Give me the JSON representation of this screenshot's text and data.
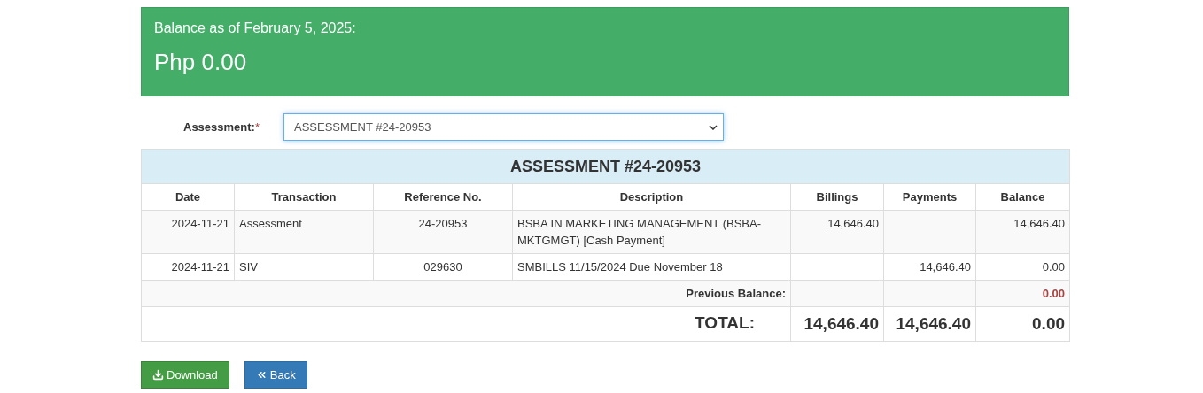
{
  "balance_card": {
    "caption": "Balance as of February 5, 2025:",
    "amount": "Php 0.00"
  },
  "assessment_select": {
    "label": "Assessment:",
    "required_mark": "*",
    "value": "ASSESSMENT #24-20953"
  },
  "table": {
    "title": "ASSESSMENT #24-20953",
    "columns": [
      "Date",
      "Transaction",
      "Reference No.",
      "Description",
      "Billings",
      "Payments",
      "Balance"
    ],
    "rows": [
      {
        "date": "2024-11-21",
        "transaction": "Assessment",
        "reference": "24-20953",
        "description": "BSBA IN MARKETING MANAGEMENT (BSBA-MKTGMGT) [Cash Payment]",
        "billings": "14,646.40",
        "payments": "",
        "balance": "14,646.40"
      },
      {
        "date": "2024-11-21",
        "transaction": "SIV",
        "reference": "029630",
        "description": "SMBILLS 11/15/2024 Due November 18",
        "billings": "",
        "payments": "14,646.40",
        "balance": "0.00"
      }
    ],
    "previous_balance": {
      "label": "Previous Balance:",
      "balance": "0.00"
    },
    "total": {
      "label": "TOTAL:",
      "billings": "14,646.40",
      "payments": "14,646.40",
      "balance": "0.00"
    }
  },
  "buttons": [
    {
      "kind": "download",
      "label": "Download"
    },
    {
      "kind": "back",
      "label": "Back"
    }
  ]
}
